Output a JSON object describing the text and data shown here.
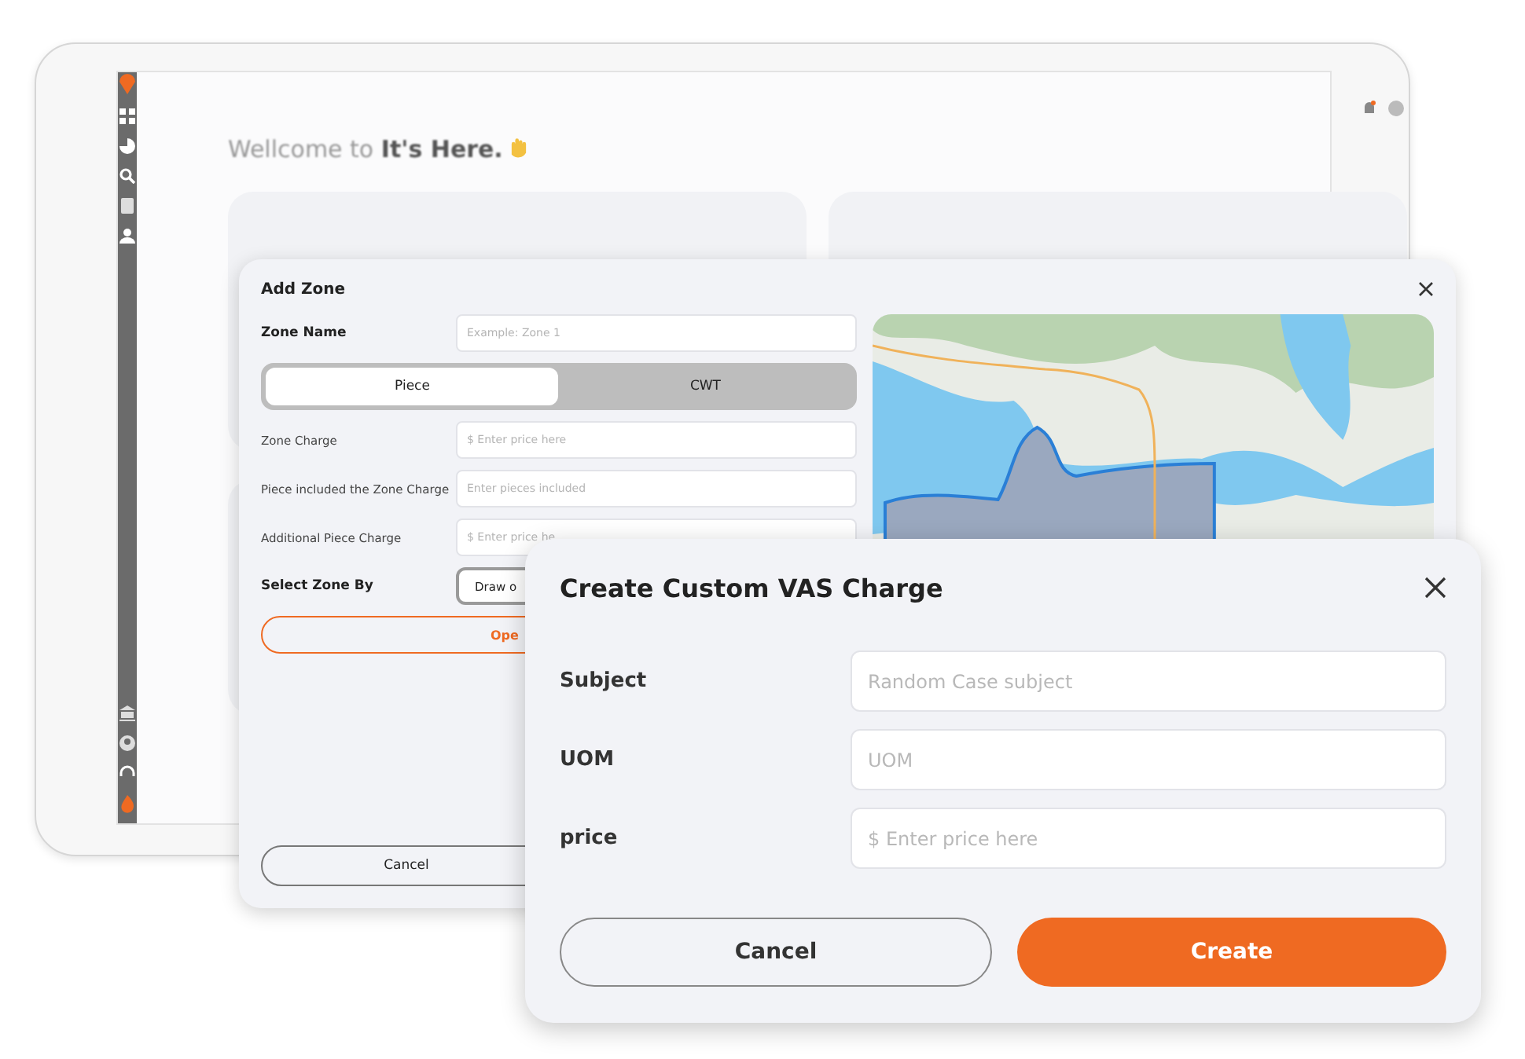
{
  "background_screen": {
    "greeting": "Wellcome to **It's Here.**"
  },
  "add_zone": {
    "title": "Add  Zone",
    "zone_name": {
      "label": "Zone Name",
      "placeholder": "Example: Zone 1"
    },
    "pricing_tabs": [
      {
        "label": "Piece",
        "selected": true
      },
      {
        "label": "CWT",
        "selected": false
      }
    ],
    "charges": [
      {
        "label": "Zone Charge",
        "placeholder": "$ Enter price here"
      },
      {
        "label": "Piece included the Zone Charge",
        "placeholder": "Enter pieces included"
      },
      {
        "label": "Additional Piece Charge",
        "placeholder": "$ Enter price he"
      }
    ],
    "select_zone_by": {
      "label": "Select Zone By",
      "button": "Draw o"
    },
    "open_button": "Ope",
    "cancel_button": "Cancel"
  },
  "vas_dialog": {
    "title": "Create Custom VAS Charge",
    "fields": [
      {
        "label": "Subject",
        "placeholder": "Random Case subject"
      },
      {
        "label": "UOM",
        "placeholder": "UOM"
      },
      {
        "label": "price",
        "placeholder": "$ Enter price here"
      }
    ],
    "cancel_button": "Cancel",
    "create_button": "Create"
  }
}
